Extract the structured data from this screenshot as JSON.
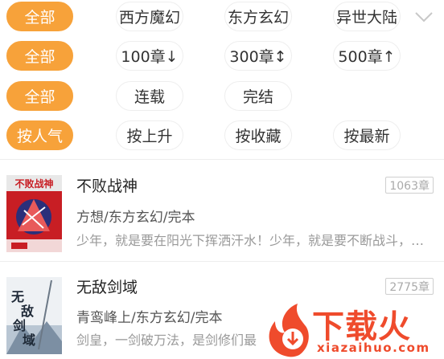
{
  "filters": {
    "genre": [
      "全部",
      "西方魔幻",
      "东方玄幻",
      "异世大陆"
    ],
    "chapters": [
      "全部",
      "100章↓",
      "300章↕",
      "500章↑"
    ],
    "status": [
      "全部",
      "连载",
      "完结"
    ],
    "sort": [
      "按人气",
      "按上升",
      "按收藏",
      "按最新"
    ]
  },
  "books": [
    {
      "title": "不败战神",
      "meta": "方想/东方玄幻/完本",
      "desc": "少年，就是要在阳光下挥洒汗水！少年，就是要不断战斗，…",
      "chapters": "1063章",
      "cover_text": "不败战神"
    },
    {
      "title": "无敌剑域",
      "meta": "青鸾峰上/东方玄幻/完本",
      "desc": "剑皇，一剑破万法，是剑修们最",
      "chapters": "2775章",
      "cover_text": "无敌剑域"
    }
  ],
  "watermark": {
    "brand": "下载火",
    "url": "xiazaihuo.com"
  },
  "colors": {
    "accent": "#f7a23a",
    "watermark": "#ef4b2c"
  }
}
